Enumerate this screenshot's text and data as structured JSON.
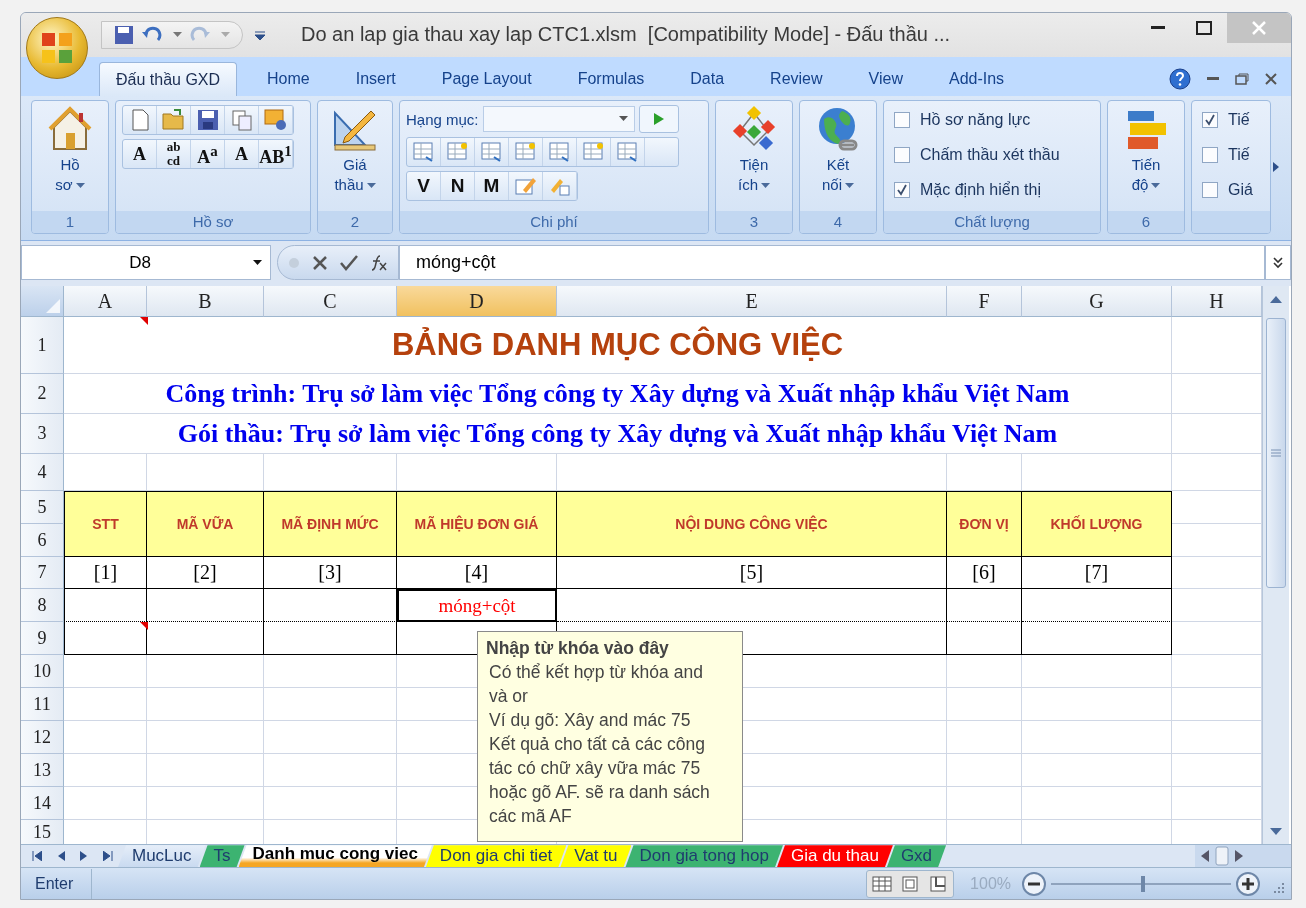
{
  "window": {
    "title": "Do an lap gia thau xay lap CTC1.xlsm  [Compatibility Mode] - Đấu thầu ..."
  },
  "ribbon_tabs": [
    {
      "label": "Đấu thầu GXD",
      "selected": true
    },
    {
      "label": "Home",
      "selected": false
    },
    {
      "label": "Insert",
      "selected": false
    },
    {
      "label": "Page Layout",
      "selected": false
    },
    {
      "label": "Formulas",
      "selected": false
    },
    {
      "label": "Data",
      "selected": false
    },
    {
      "label": "Review",
      "selected": false
    },
    {
      "label": "View",
      "selected": false
    },
    {
      "label": "Add-Ins",
      "selected": false
    }
  ],
  "ribbon_groups": [
    {
      "kind": "large",
      "label": "1",
      "button": {
        "label": "Hồ sơ"
      }
    },
    {
      "kind": "tools",
      "label": "Hồ sơ",
      "font_buttons": [
        {
          "label": "A"
        },
        {
          "label": "ab cd"
        },
        {
          "label": "A$^{a}$"
        },
        {
          "label": "A"
        },
        {
          "label": "AB$^{1}$"
        }
      ]
    },
    {
      "kind": "large",
      "label": "2",
      "button": {
        "label": "Giá thầu"
      }
    },
    {
      "kind": "costs",
      "label": "Chi phí",
      "combo": {
        "label": "Hạng mục:"
      },
      "letter_buttons": [
        {
          "label": "V"
        },
        {
          "label": "N"
        },
        {
          "label": "M"
        }
      ]
    },
    {
      "kind": "large",
      "label": "3",
      "button": {
        "label": "Tiện ích"
      }
    },
    {
      "kind": "large",
      "label": "4",
      "button": {
        "label": "Kết nối"
      }
    },
    {
      "kind": "checks",
      "label": "Chất lượng",
      "checkboxes": [
        {
          "label": "Hồ sơ năng lực",
          "checked": false
        },
        {
          "label": "Chấm thầu xét thầu",
          "checked": false
        },
        {
          "label": "Mặc định hiển thị",
          "checked": true
        }
      ]
    },
    {
      "kind": "large",
      "label": "6",
      "button": {
        "label": "Tiến độ"
      }
    },
    {
      "kind": "checks",
      "checkboxes": [
        {
          "label": "Tiế",
          "checked": true
        },
        {
          "label": "Tiế",
          "checked": false
        },
        {
          "label": "Giá",
          "checked": false
        }
      ]
    }
  ],
  "formula_bar": {
    "name_box": "D8",
    "formula": "móng+cột"
  },
  "sheet": {
    "columns": [
      {
        "label": "A",
        "selected": false
      },
      {
        "label": "B",
        "selected": false
      },
      {
        "label": "C",
        "selected": false
      },
      {
        "label": "D",
        "selected": true
      },
      {
        "label": "E",
        "selected": false
      },
      {
        "label": "F",
        "selected": false
      },
      {
        "label": "G",
        "selected": false
      },
      {
        "label": "H",
        "selected": false
      }
    ],
    "rows": [
      {
        "label": "1",
        "comment": true
      },
      {
        "label": "2",
        "comment": false
      },
      {
        "label": "3",
        "comment": false
      },
      {
        "label": "4",
        "comment": false
      },
      {
        "label": "5",
        "comment": false
      },
      {
        "label": "6",
        "comment": false
      },
      {
        "label": "7",
        "comment": false
      },
      {
        "label": "8",
        "comment": false
      },
      {
        "label": "9",
        "comment": true
      },
      {
        "label": "10",
        "comment": false
      },
      {
        "label": "11",
        "comment": false
      },
      {
        "label": "12",
        "comment": false
      },
      {
        "label": "13",
        "comment": false
      },
      {
        "label": "14",
        "comment": false
      },
      {
        "label": "15",
        "comment": false
      }
    ],
    "title": "BẢNG DANH MỤC CÔNG VIỆC",
    "lines": [
      "Công trình: Trụ sở làm việc Tổng công ty Xây dựng và Xuất nhập khẩu Việt Nam",
      "Gói thầu: Trụ sở làm việc Tổng công ty Xây dựng và Xuất nhập khẩu Việt Nam"
    ],
    "headers": [
      "STT",
      "MÃ VỮA",
      "MÃ ĐỊNH MỨC",
      "MÃ HIỆU ĐƠN GIÁ",
      "NỘI DUNG CÔNG VIỆC",
      "ĐƠN VỊ",
      "KHỐI LƯỢNG"
    ],
    "index_row": [
      "[1]",
      "[2]",
      "[3]",
      "[4]",
      "[5]",
      "[6]",
      "[7]"
    ],
    "active_cell": {
      "value": "móng+cột"
    }
  },
  "tooltip": {
    "title": "Nhập từ khóa vào đây",
    "paragraphs": [
      "Có thể kết hợp từ khóa and và or",
      "Ví dụ gõ: Xây and mác 75",
      "Kết quả cho tất cả các công tác có chữ xây vữa mác 75 hoặc gõ AF. sẽ ra danh sách các mã AF"
    ]
  },
  "sheet_tabs": [
    {
      "label": "MucLuc",
      "selected": false
    },
    {
      "label": "Ts",
      "selected": false,
      "color": "#3cb371"
    },
    {
      "label": "Danh muc cong viec",
      "selected": true,
      "color": "#f5a623"
    },
    {
      "label": "Don gia chi tiet",
      "selected": false,
      "color": "#ffff00"
    },
    {
      "label": "Vat tu",
      "selected": false,
      "color": "#ffff00"
    },
    {
      "label": "Don gia tong hop",
      "selected": false,
      "color": "#3cb371"
    },
    {
      "label": "Gia du thau",
      "selected": false,
      "color": "#ff0000"
    },
    {
      "label": "Gxd",
      "selected": false,
      "color": "#3cb371"
    }
  ],
  "status_bar": {
    "mode": "Enter",
    "zoom": "100%",
    "level": 0.5
  }
}
